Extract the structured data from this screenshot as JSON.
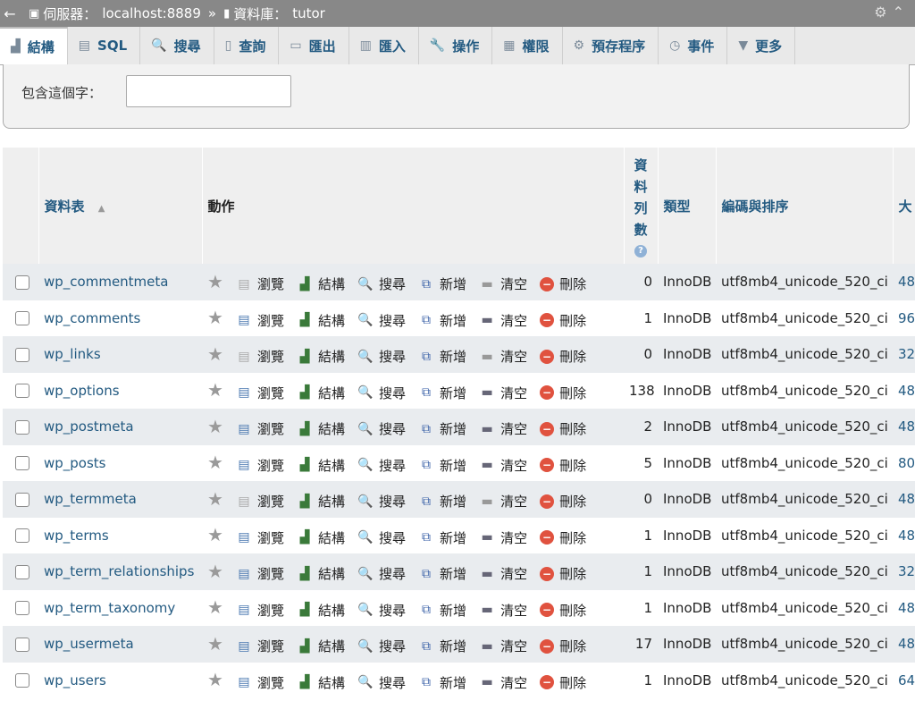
{
  "breadcrumb": {
    "server_label": "伺服器：",
    "server": "localhost:8889",
    "sep": "»",
    "db_label": "資料庫：",
    "db": "tutor"
  },
  "tabs": [
    {
      "label": "結構",
      "icon": "structure-icon"
    },
    {
      "label": "SQL",
      "icon": "sql-icon"
    },
    {
      "label": "搜尋",
      "icon": "search-icon"
    },
    {
      "label": "查詢",
      "icon": "query-icon"
    },
    {
      "label": "匯出",
      "icon": "export-icon"
    },
    {
      "label": "匯入",
      "icon": "import-icon"
    },
    {
      "label": "操作",
      "icon": "wrench-icon"
    },
    {
      "label": "權限",
      "icon": "privileges-icon"
    },
    {
      "label": "預存程序",
      "icon": "routines-icon"
    },
    {
      "label": "事件",
      "icon": "events-icon"
    },
    {
      "label": "更多",
      "icon": "chevron-down-icon"
    }
  ],
  "filter": {
    "label": "包含這個字：",
    "value": ""
  },
  "columns": {
    "table": "資料表",
    "action": "動作",
    "rows": [
      "資",
      "料",
      "列",
      "數"
    ],
    "type": "類型",
    "collation": "編碼與排序",
    "size": "大"
  },
  "actions": {
    "browse": "瀏覽",
    "structure": "結構",
    "search": "搜尋",
    "insert": "新增",
    "empty": "清空",
    "drop": "刪除"
  },
  "rows": [
    {
      "name": "wp_commentmeta",
      "rows": "0",
      "type": "InnoDB",
      "collation": "utf8mb4_unicode_520_ci",
      "size": "48"
    },
    {
      "name": "wp_comments",
      "rows": "1",
      "type": "InnoDB",
      "collation": "utf8mb4_unicode_520_ci",
      "size": "96"
    },
    {
      "name": "wp_links",
      "rows": "0",
      "type": "InnoDB",
      "collation": "utf8mb4_unicode_520_ci",
      "size": "32"
    },
    {
      "name": "wp_options",
      "rows": "138",
      "type": "InnoDB",
      "collation": "utf8mb4_unicode_520_ci",
      "size": "48"
    },
    {
      "name": "wp_postmeta",
      "rows": "2",
      "type": "InnoDB",
      "collation": "utf8mb4_unicode_520_ci",
      "size": "48"
    },
    {
      "name": "wp_posts",
      "rows": "5",
      "type": "InnoDB",
      "collation": "utf8mb4_unicode_520_ci",
      "size": "80"
    },
    {
      "name": "wp_termmeta",
      "rows": "0",
      "type": "InnoDB",
      "collation": "utf8mb4_unicode_520_ci",
      "size": "48"
    },
    {
      "name": "wp_terms",
      "rows": "1",
      "type": "InnoDB",
      "collation": "utf8mb4_unicode_520_ci",
      "size": "48"
    },
    {
      "name": "wp_term_relationships",
      "rows": "1",
      "type": "InnoDB",
      "collation": "utf8mb4_unicode_520_ci",
      "size": "32"
    },
    {
      "name": "wp_term_taxonomy",
      "rows": "1",
      "type": "InnoDB",
      "collation": "utf8mb4_unicode_520_ci",
      "size": "48"
    },
    {
      "name": "wp_usermeta",
      "rows": "17",
      "type": "InnoDB",
      "collation": "utf8mb4_unicode_520_ci",
      "size": "48"
    },
    {
      "name": "wp_users",
      "rows": "1",
      "type": "InnoDB",
      "collation": "utf8mb4_unicode_520_ci",
      "size": "64"
    }
  ]
}
